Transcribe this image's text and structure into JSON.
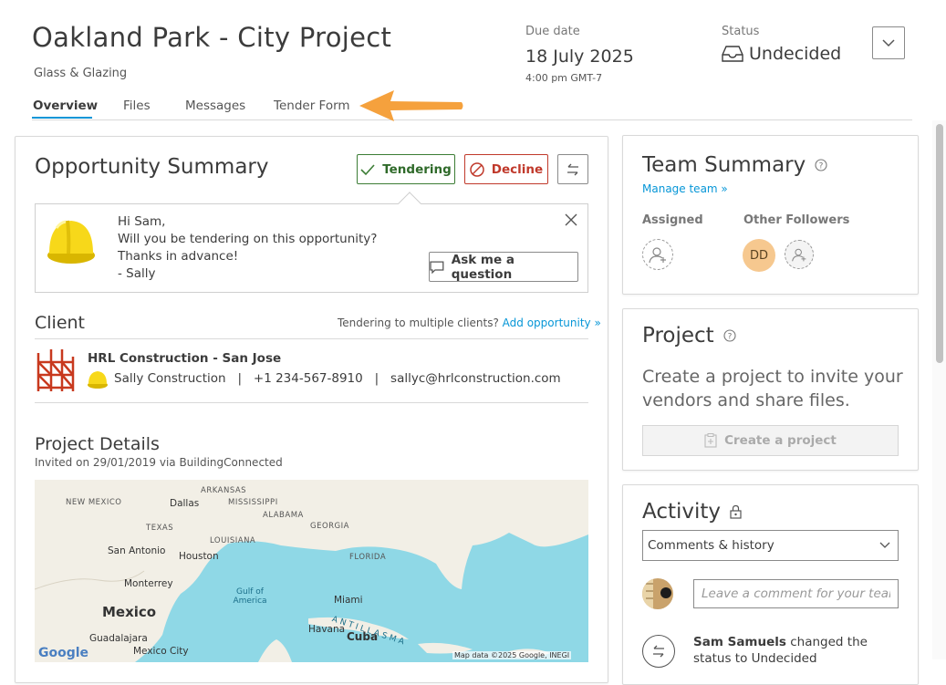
{
  "header": {
    "title": "Oakland Park - City Project",
    "subtitle": "Glass & Glazing",
    "due_label": "Due date",
    "due_date": "18 July 2025",
    "due_time": "4:00 pm GMT-7",
    "status_label": "Status",
    "status_value": "Undecided"
  },
  "tabs": [
    {
      "label": "Overview",
      "active": true
    },
    {
      "label": "Files"
    },
    {
      "label": "Messages"
    },
    {
      "label": "Tender Form"
    }
  ],
  "opportunity": {
    "title": "Opportunity Summary",
    "tender_label": "Tendering",
    "decline_label": "Decline",
    "message_lines": [
      "Hi Sam,",
      "Will you be tendering on this opportunity?",
      "Thanks in advance!",
      "- Sally"
    ],
    "ask_label": "Ask me a question"
  },
  "client": {
    "title": "Client",
    "note": "Tendering to multiple clients?",
    "add_link": "Add opportunity »",
    "company": "HRL Construction - San Jose",
    "contact_name": "Sally Construction",
    "phone": "+1 234-567-8910",
    "email": "sallyc@hrlconstruction.com"
  },
  "project_details": {
    "title": "Project Details",
    "invited": "Invited on 29/01/2019 via BuildingConnected",
    "map_labels": {
      "new_mexico": "NEW MEXICO",
      "dallas": "Dallas",
      "arkansas": "ARKANSAS",
      "mississippi": "MISSISSIPPI",
      "alabama": "ALABAMA",
      "georgia": "GEORGIA",
      "texas": "TEXAS",
      "louisiana": "LOUISIANA",
      "florida": "FLORIDA",
      "san_antonio": "San Antonio",
      "houston": "Houston",
      "monterrey": "Monterrey",
      "gulf": "Gulf of America",
      "miami": "Miami",
      "mexico": "Mexico",
      "guadalajara": "Guadalajara",
      "havana": "Havana",
      "cuba": "Cuba",
      "antillas": "A N T I L L A S   M A",
      "mexico_city": "Mexico City",
      "google": "Google",
      "attribution": "Map data ©2025 Google, INEGI"
    }
  },
  "team": {
    "title": "Team Summary",
    "manage_link": "Manage team »",
    "assigned_label": "Assigned",
    "followers_label": "Other Followers",
    "follower_initials": "DD"
  },
  "project": {
    "title": "Project",
    "text": "Create a project to invite your vendors and share files.",
    "create_label": "Create a project"
  },
  "activity": {
    "title": "Activity",
    "filter_value": "Comments & history",
    "comment_placeholder": "Leave a comment for your team",
    "history_user": "Sam Samuels",
    "history_text": " changed the status to Undecided"
  },
  "colors": {
    "accent": "#0696d7",
    "tender_green": "#3c7d35",
    "decline_red": "#c0392b",
    "arrow_orange": "#f5a13d",
    "avatar_dd": "#f6c88f",
    "map_water": "#8fd8e6",
    "map_land": "#f2efe6"
  },
  "icons": [
    "chevron-down-icon",
    "inbox-icon",
    "check-icon",
    "prohibited-icon",
    "swap-arrows-icon",
    "close-icon",
    "chat-bubble-icon",
    "help-circle-icon",
    "add-user-icon",
    "clipboard-plus-icon",
    "lock-icon",
    "hard-hat-icon",
    "scaffold-logo-icon"
  ]
}
